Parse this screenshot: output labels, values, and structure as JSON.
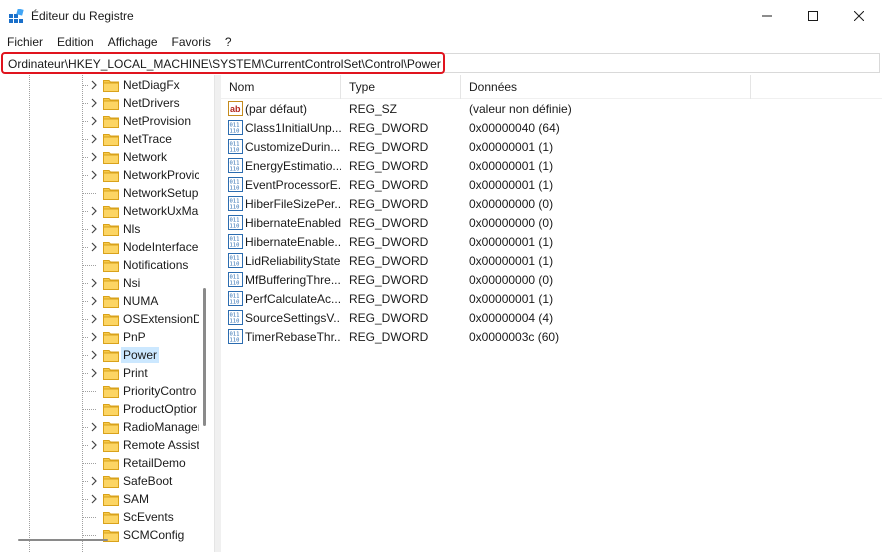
{
  "window": {
    "title": "Éditeur du Registre",
    "icon": "regedit-icon"
  },
  "menu": [
    "Fichier",
    "Edition",
    "Affichage",
    "Favoris",
    "?"
  ],
  "address": {
    "path": "Ordinateur\\HKEY_LOCAL_MACHINE\\SYSTEM\\CurrentControlSet\\Control\\Power",
    "highlight_color": "#e0141e"
  },
  "tree": {
    "selected": "Power",
    "items": [
      {
        "label": "NetDiagFx",
        "expandable": true
      },
      {
        "label": "NetDrivers",
        "expandable": true
      },
      {
        "label": "NetProvision",
        "expandable": true
      },
      {
        "label": "NetTrace",
        "expandable": true
      },
      {
        "label": "Network",
        "expandable": true
      },
      {
        "label": "NetworkProvic",
        "expandable": true
      },
      {
        "label": "NetworkSetup",
        "expandable": false
      },
      {
        "label": "NetworkUxMa",
        "expandable": true
      },
      {
        "label": "Nls",
        "expandable": true
      },
      {
        "label": "NodeInterface",
        "expandable": true
      },
      {
        "label": "Notifications",
        "expandable": false
      },
      {
        "label": "Nsi",
        "expandable": true
      },
      {
        "label": "NUMA",
        "expandable": true
      },
      {
        "label": "OSExtensionD",
        "expandable": true
      },
      {
        "label": "PnP",
        "expandable": true
      },
      {
        "label": "Power",
        "expandable": true
      },
      {
        "label": "Print",
        "expandable": true
      },
      {
        "label": "PriorityContro",
        "expandable": false
      },
      {
        "label": "ProductOptior",
        "expandable": false
      },
      {
        "label": "RadioManager",
        "expandable": true
      },
      {
        "label": "Remote Assist",
        "expandable": true
      },
      {
        "label": "RetailDemo",
        "expandable": false
      },
      {
        "label": "SafeBoot",
        "expandable": true
      },
      {
        "label": "SAM",
        "expandable": true
      },
      {
        "label": "ScEvents",
        "expandable": false
      },
      {
        "label": "SCMConfig",
        "expandable": false
      }
    ]
  },
  "list": {
    "columns": [
      "Nom",
      "Type",
      "Données"
    ],
    "rows": [
      {
        "name": "(par défaut)",
        "type": "REG_SZ",
        "data": "(valeur non définie)",
        "icon": "string-value-icon"
      },
      {
        "name": "Class1InitialUnp...",
        "type": "REG_DWORD",
        "data": "0x00000040 (64)",
        "icon": "binary-value-icon"
      },
      {
        "name": "CustomizeDurin...",
        "type": "REG_DWORD",
        "data": "0x00000001 (1)",
        "icon": "binary-value-icon"
      },
      {
        "name": "EnergyEstimatio...",
        "type": "REG_DWORD",
        "data": "0x00000001 (1)",
        "icon": "binary-value-icon"
      },
      {
        "name": "EventProcessorE...",
        "type": "REG_DWORD",
        "data": "0x00000001 (1)",
        "icon": "binary-value-icon"
      },
      {
        "name": "HiberFileSizePer...",
        "type": "REG_DWORD",
        "data": "0x00000000 (0)",
        "icon": "binary-value-icon"
      },
      {
        "name": "HibernateEnabled",
        "type": "REG_DWORD",
        "data": "0x00000000 (0)",
        "icon": "binary-value-icon"
      },
      {
        "name": "HibernateEnable...",
        "type": "REG_DWORD",
        "data": "0x00000001 (1)",
        "icon": "binary-value-icon"
      },
      {
        "name": "LidReliabilityState",
        "type": "REG_DWORD",
        "data": "0x00000001 (1)",
        "icon": "binary-value-icon"
      },
      {
        "name": "MfBufferingThre...",
        "type": "REG_DWORD",
        "data": "0x00000000 (0)",
        "icon": "binary-value-icon"
      },
      {
        "name": "PerfCalculateAc...",
        "type": "REG_DWORD",
        "data": "0x00000001 (1)",
        "icon": "binary-value-icon"
      },
      {
        "name": "SourceSettingsV...",
        "type": "REG_DWORD",
        "data": "0x00000004 (4)",
        "icon": "binary-value-icon"
      },
      {
        "name": "TimerRebaseThr...",
        "type": "REG_DWORD",
        "data": "0x0000003c (60)",
        "icon": "binary-value-icon"
      }
    ]
  }
}
